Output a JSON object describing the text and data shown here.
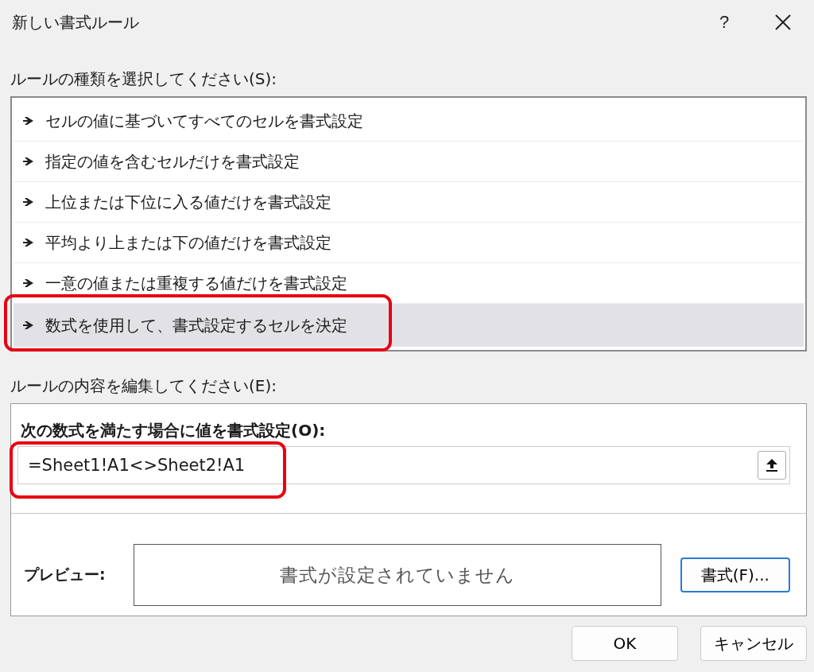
{
  "window": {
    "title": "新しい書式ルール",
    "help": "?"
  },
  "rule_type_label": "ルールの種類を選択してください(S):",
  "rule_types": [
    {
      "label": "セルの値に基づいてすべてのセルを書式設定",
      "selected": false,
      "highlighted": false
    },
    {
      "label": "指定の値を含むセルだけを書式設定",
      "selected": false,
      "highlighted": false
    },
    {
      "label": "上位または下位に入る値だけを書式設定",
      "selected": false,
      "highlighted": false
    },
    {
      "label": "平均より上または下の値だけを書式設定",
      "selected": false,
      "highlighted": false
    },
    {
      "label": "一意の値または重複する値だけを書式設定",
      "selected": false,
      "highlighted": false
    },
    {
      "label": "数式を使用して、書式設定するセルを決定",
      "selected": true,
      "highlighted": true
    }
  ],
  "edit_label": "ルールの内容を編集してください(E):",
  "formula_label": "次の数式を満たす場合に値を書式設定(O):",
  "formula": {
    "value": "=Sheet1!A1<>Sheet2!A1",
    "highlighted": true
  },
  "preview_label": "プレビュー:",
  "preview_text": "書式が設定されていません",
  "format_button": "書式(F)...",
  "buttons": [
    "OK",
    "キャンセル"
  ]
}
